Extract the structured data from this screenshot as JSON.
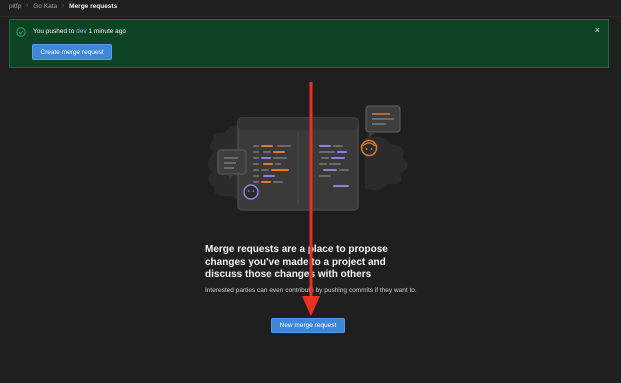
{
  "breadcrumb": {
    "items": [
      "pitfp",
      "Go Kata",
      "Merge requests"
    ]
  },
  "alert": {
    "message_prefix": "You pushed to",
    "branch": "dev",
    "message_suffix": "1 minute ago",
    "button_label": "Create merge request",
    "close_symbol": "×",
    "icon": "check-circle-icon",
    "colors": {
      "background": "#0e4425",
      "success": "#2da160"
    }
  },
  "empty_state": {
    "title": "Merge requests are a place to propose changes you've made to a project and discuss those changes with others",
    "description": "Interested parties can even contribute by pushing commits if they want to.",
    "button_label": "New merge request"
  },
  "annotation": {
    "type": "red-arrow",
    "color": "#e8321f"
  },
  "colors": {
    "accent_blue": "#3d86d8",
    "illustration_orange": "#e2772e",
    "illustration_purple": "#8f7ee0"
  }
}
